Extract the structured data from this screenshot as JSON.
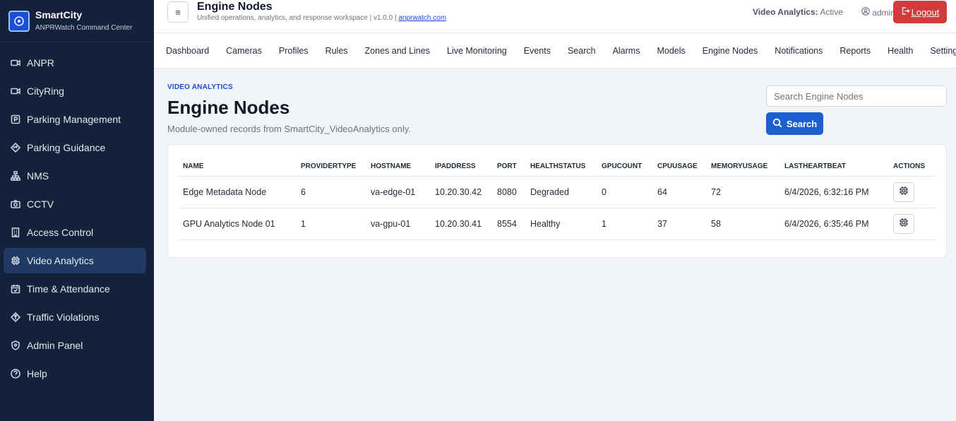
{
  "brand": {
    "title": "SmartCity",
    "subtitle": "ANPRWatch Command Center"
  },
  "sidebar": {
    "items": [
      {
        "label": "ANPR",
        "icon": "camera-icon"
      },
      {
        "label": "CityRing",
        "icon": "camera-icon"
      },
      {
        "label": "Parking Management",
        "icon": "parking-icon"
      },
      {
        "label": "Parking Guidance",
        "icon": "diamond-icon"
      },
      {
        "label": "NMS",
        "icon": "network-icon"
      },
      {
        "label": "CCTV",
        "icon": "camera-icon"
      },
      {
        "label": "Access Control",
        "icon": "building-icon"
      },
      {
        "label": "Video Analytics",
        "icon": "chip-icon",
        "active": true
      },
      {
        "label": "Time & Attendance",
        "icon": "calendar-icon"
      },
      {
        "label": "Traffic Violations",
        "icon": "diamond-icon"
      },
      {
        "label": "Admin Panel",
        "icon": "shield-icon"
      },
      {
        "label": "Help",
        "icon": "help-icon"
      }
    ]
  },
  "header": {
    "menu_icon": "≡",
    "title": "Engine Nodes",
    "subtitle": "Unified operations, analytics, and response workspace | v1.0.0 |",
    "link": "anprwatch.com",
    "status_label": "Video Analytics:",
    "status_value": "Active",
    "user": "admin",
    "logout": "Logout"
  },
  "topnav": [
    "Dashboard",
    "Cameras",
    "Profiles",
    "Rules",
    "Zones and Lines",
    "Live Monitoring",
    "Events",
    "Search",
    "Alarms",
    "Models",
    "Engine Nodes",
    "Notifications",
    "Reports",
    "Health",
    "Settings"
  ],
  "main": {
    "eyebrow": "VIDEO ANALYTICS",
    "title": "Engine Nodes",
    "description": "Module-owned records from SmartCity_VideoAnalytics only.",
    "search_placeholder": "Search Engine Nodes",
    "search_button": "Search"
  },
  "table": {
    "columns": [
      "NAME",
      "PROVIDERTYPE",
      "HOSTNAME",
      "IPADDRESS",
      "PORT",
      "HEALTHSTATUS",
      "GPUCOUNT",
      "CPUUSAGE",
      "MEMORYUSAGE",
      "LASTHEARTBEAT",
      "ACTIONS"
    ],
    "rows": [
      [
        "Edge Metadata Node",
        "6",
        "va-edge-01",
        "10.20.30.42",
        "8080",
        "Degraded",
        "0",
        "64",
        "72",
        "6/4/2026, 6:32:16 PM"
      ],
      [
        "GPU Analytics Node 01",
        "1",
        "va-gpu-01",
        "10.20.30.41",
        "8554",
        "Healthy",
        "1",
        "37",
        "58",
        "6/4/2026, 6:35:46 PM"
      ]
    ]
  }
}
